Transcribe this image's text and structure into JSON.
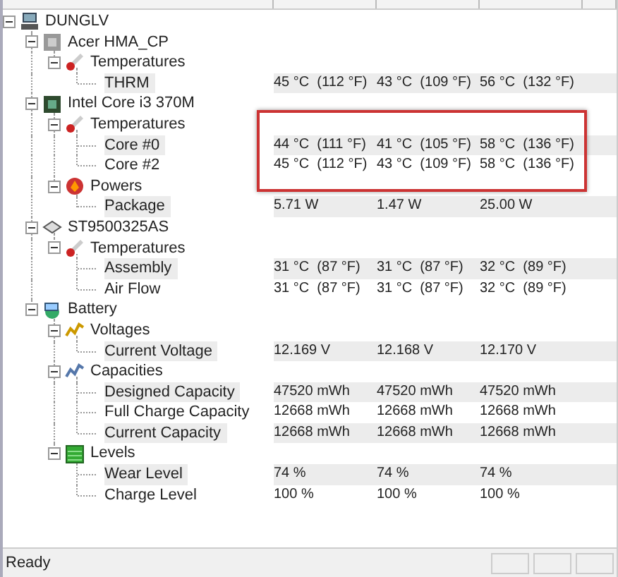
{
  "tree": [
    {
      "label": "DUNGLV",
      "kind": "computer",
      "expanded": true,
      "children": [
        {
          "label": "Acer HMA_CP",
          "kind": "board",
          "expanded": true,
          "children": [
            {
              "label": "Temperatures",
              "kind": "temperature",
              "expanded": true,
              "children": [
                {
                  "label": "THRM",
                  "value": "45 °C  (112 °F)",
                  "min": "43 °C  (109 °F)",
                  "max": "56 °C  (132 °F)"
                }
              ]
            }
          ]
        },
        {
          "label": "Intel Core i3 370M",
          "kind": "cpu",
          "expanded": true,
          "children": [
            {
              "label": "Temperatures",
              "kind": "temperature",
              "expanded": true,
              "children": [
                {
                  "label": "Core #0",
                  "value": "44 °C  (111 °F)",
                  "min": "41 °C  (105 °F)",
                  "max": "58 °C  (136 °F)"
                },
                {
                  "label": "Core #2",
                  "value": "45 °C  (112 °F)",
                  "min": "43 °C  (109 °F)",
                  "max": "58 °C  (136 °F)"
                }
              ]
            },
            {
              "label": "Powers",
              "kind": "power",
              "expanded": true,
              "children": [
                {
                  "label": "Package",
                  "value": "5.71 W",
                  "min": "1.47 W",
                  "max": "25.00 W"
                }
              ]
            }
          ]
        },
        {
          "label": "ST9500325AS",
          "kind": "disk",
          "expanded": true,
          "children": [
            {
              "label": "Temperatures",
              "kind": "temperature",
              "expanded": true,
              "children": [
                {
                  "label": "Assembly",
                  "value": "31 °C  (87 °F)",
                  "min": "31 °C  (87 °F)",
                  "max": "32 °C  (89 °F)"
                },
                {
                  "label": "Air Flow",
                  "value": "31 °C  (87 °F)",
                  "min": "31 °C  (87 °F)",
                  "max": "32 °C  (89 °F)"
                }
              ]
            }
          ]
        },
        {
          "label": "Battery",
          "kind": "battery",
          "expanded": true,
          "children": [
            {
              "label": "Voltages",
              "kind": "voltage",
              "expanded": true,
              "children": [
                {
                  "label": "Current Voltage",
                  "value": "12.169 V",
                  "min": "12.168 V",
                  "max": "12.170 V"
                }
              ]
            },
            {
              "label": "Capacities",
              "kind": "capacity",
              "expanded": true,
              "children": [
                {
                  "label": "Designed Capacity",
                  "value": "47520 mWh",
                  "min": "47520 mWh",
                  "max": "47520 mWh"
                },
                {
                  "label": "Full Charge Capacity",
                  "value": "12668 mWh",
                  "min": "12668 mWh",
                  "max": "12668 mWh"
                },
                {
                  "label": "Current Capacity",
                  "value": "12668 mWh",
                  "min": "12668 mWh",
                  "max": "12668 mWh"
                }
              ]
            },
            {
              "label": "Levels",
              "kind": "level",
              "expanded": true,
              "children": [
                {
                  "label": "Wear Level",
                  "value": "74 %",
                  "min": "74 %",
                  "max": "74 %"
                },
                {
                  "label": "Charge Level",
                  "value": "100 %",
                  "min": "100 %",
                  "max": "100 %"
                }
              ]
            }
          ]
        }
      ]
    }
  ],
  "status_bar": {
    "text": "Ready"
  }
}
